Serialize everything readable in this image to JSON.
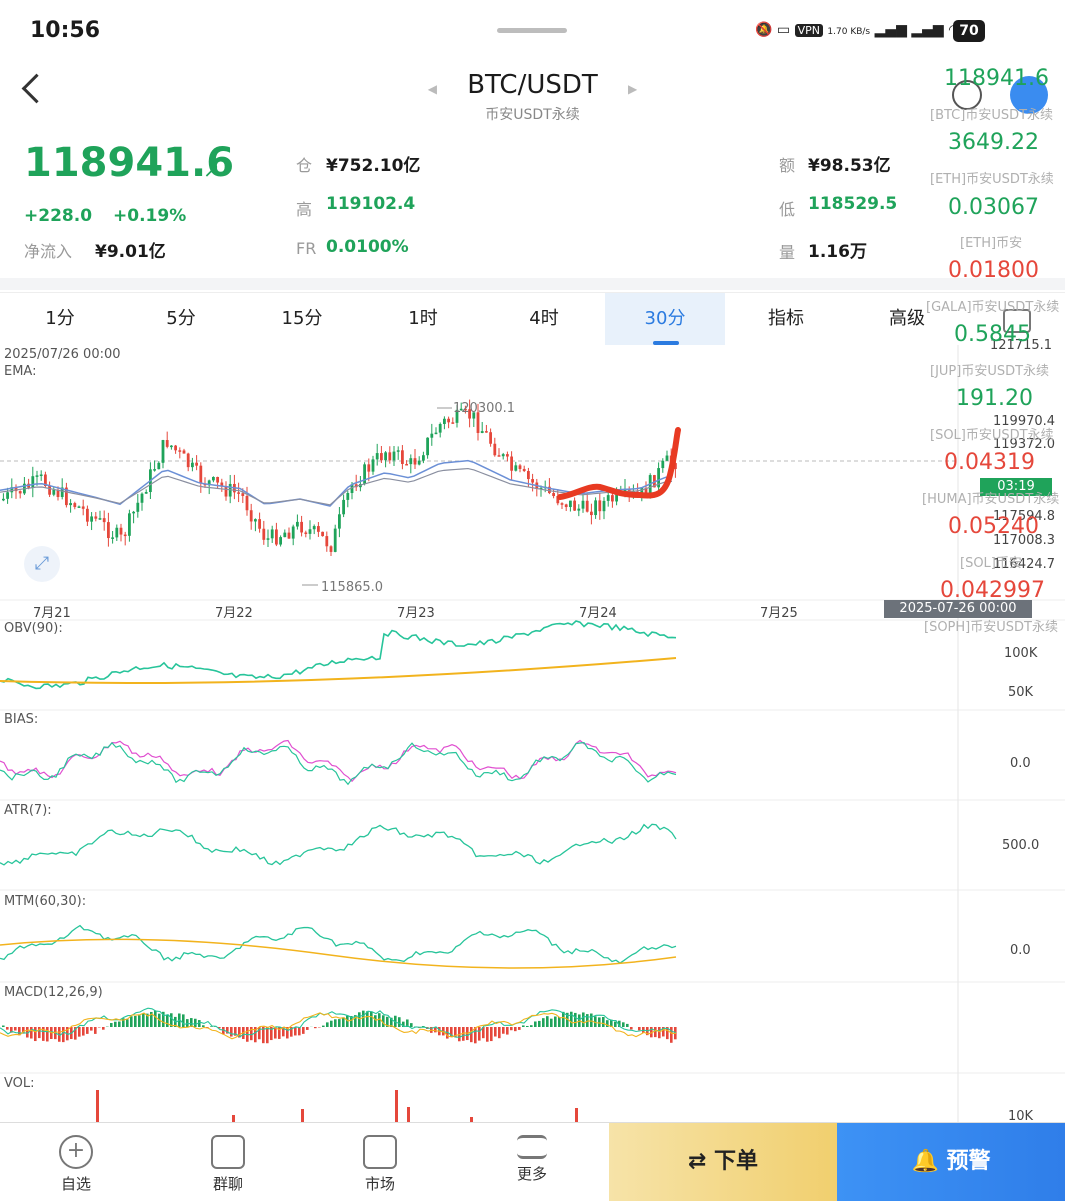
{
  "status_bar": {
    "time": "10:56",
    "net_speed": "1.70 KB/s",
    "battery": "70",
    "vpn": "VPN"
  },
  "header": {
    "pair": "BTC/USDT",
    "market": "币安USDT永续"
  },
  "ticker": {
    "price": "118941.6",
    "change": "+228.0",
    "change_pct": "+0.19%",
    "net_inflow_label": "净流入",
    "net_inflow": "¥9.01亿",
    "oi_label": "仓",
    "oi": "¥752.10亿",
    "high_label": "高",
    "high": "119102.4",
    "fr_label": "FR",
    "fr": "0.0100%",
    "amount_label": "额",
    "amount": "¥98.53亿",
    "low_label": "低",
    "low": "118529.5",
    "volume_label": "量",
    "volume": "1.16万"
  },
  "tabs": [
    {
      "label": "1分"
    },
    {
      "label": "5分"
    },
    {
      "label": "15分"
    },
    {
      "label": "1时"
    },
    {
      "label": "4时"
    },
    {
      "label": "30分"
    },
    {
      "label": "指标"
    },
    {
      "label": "高级"
    }
  ],
  "active_tab": "30分",
  "chart": {
    "date_header": "2025/07/26 00:00",
    "ema_label": "EMA:",
    "high_mark": "120300.1",
    "low_mark": "115865.0",
    "crosshair_date": "2025-07-26 00:00",
    "countdown": "03:19",
    "x_dates": [
      "7月21",
      "7月22",
      "7月23",
      "7月24",
      "7月25"
    ],
    "y_ticks": [
      "121715.1",
      "119970.4",
      "119372.0",
      "117594.8",
      "117008.3",
      "116424.7"
    ],
    "obv_label": "OBV(90):",
    "obv_ticks": [
      "100K",
      "50K"
    ],
    "bias_label": "BIAS:",
    "bias_tick": "0.0",
    "atr_label": "ATR(7):",
    "atr_tick": "500.0",
    "mtm_label": "MTM(60,30):",
    "mtm_tick": "0.0",
    "macd_label": "MACD(12,26,9)",
    "vol_label": "VOL:",
    "vol_tick": "10K"
  },
  "watchlist_overlay": [
    {
      "value": "118941.6",
      "name": "[BTC]币安USDT永续",
      "color": "#1fa35a"
    },
    {
      "value": "3649.22",
      "name": "[ETH]币安USDT永续",
      "color": "#1fa35a"
    },
    {
      "value": "0.03067",
      "name": "[ETH]币安",
      "color": "#1fa35a"
    },
    {
      "value": "0.01800",
      "name": "[GALA]币安USDT永续",
      "color": "#e5473b"
    },
    {
      "value": "0.5845",
      "name": "[JUP]币安USDT永续",
      "color": "#1fa35a"
    },
    {
      "value": "191.20",
      "name": "[SOL]币安USDT永续",
      "color": "#1fa35a"
    },
    {
      "value": "0.04319",
      "name": "[HUMA]币安USDT永续",
      "color": "#e5473b"
    },
    {
      "value": "0.05240",
      "name": "[SOL]币安",
      "color": "#e5473b"
    },
    {
      "value": "0.042997",
      "name": "[SOPH]币安USDT永续",
      "color": "#e5473b"
    }
  ],
  "bottom_nav": [
    {
      "label": "自选",
      "icon": "add-circle-icon"
    },
    {
      "label": "群聊",
      "icon": "chat-icon"
    },
    {
      "label": "市场",
      "icon": "market-chart-icon"
    },
    {
      "label": "更多",
      "icon": "more-sliders-icon"
    }
  ],
  "actions": {
    "order": "下单",
    "alert": "预警"
  },
  "colors": {
    "up": "#1fa35a",
    "down": "#e5473b",
    "accent": "#2b7be0",
    "annotation": "#e83a22"
  }
}
